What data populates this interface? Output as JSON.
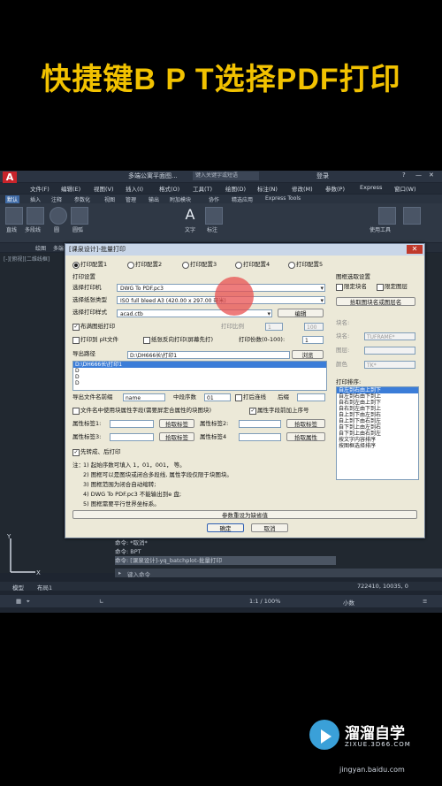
{
  "headline": "快捷键B P T选择PDF打印",
  "app": {
    "title_doc": "多端公寓平面图...",
    "search_placeholder": "键入关键字或短语",
    "login": "登录",
    "menu": [
      "文件(F)",
      "编辑(E)",
      "视图(V)",
      "插入(I)",
      "格式(O)",
      "工具(T)",
      "绘图(D)",
      "标注(N)",
      "修改(M)",
      "参数(P)",
      "Express",
      "窗口(W)"
    ],
    "ribbon_tabs": [
      "默认",
      "插入",
      "注释",
      "参数化",
      "视图",
      "管理",
      "输出",
      "附加模块",
      "协作",
      "精选应用",
      "Express Tools"
    ],
    "ribbon_buttons": [
      "直线",
      "多段线",
      "圆",
      "圆弧",
      "文字",
      "标注",
      "使用工具"
    ],
    "drawing_tabs": [
      "绘图",
      "多端公寓平面图"
    ],
    "viewport_label": "[-][俯视][二维线框]",
    "cmd_history": [
      "命令: *取消*",
      "命令: BPT",
      "命令: [课泉设计]-yq_batchplot-批量打印"
    ],
    "cmd_prompt": "键入命令",
    "layout_tabs": [
      "模型",
      "布局1"
    ],
    "coords": "722410, 10035, 0",
    "scale": "1:1 / 100%",
    "units": "小数"
  },
  "dialog": {
    "title": "[课泉设计]-批量打印",
    "configs": [
      "打印配置1",
      "打印配置2",
      "打印配置3",
      "打印配置4",
      "打印配置5"
    ],
    "print_settings": "打印设置",
    "label_printer": "选择打印机",
    "printer": "DWG To PDF.pc3",
    "label_paper": "选择纸张类型",
    "paper": "ISO full bleed A3 (420.00 x 297.00 毫米)",
    "label_style": "选择打印样式",
    "style": "acad.ctb",
    "edit": "编辑",
    "layout_print": "布满图纸打印",
    "scale_label": "打印比例",
    "scale_a": "1",
    "scale_b": "100",
    "plt_file": "打印到 plt文件",
    "reverse": "纸张反向打印(屏幕先打)",
    "copies_label": "打印份数(0-100):",
    "copies": "1",
    "export_path_label": "导出路径",
    "export_path": "D:\\DH666长\\打印1",
    "browse": "浏览",
    "path_list": [
      "D:\\DH666长\\打印1",
      "D",
      "D",
      "D"
    ],
    "filename_label": "导出文件名前缀",
    "filename": "name",
    "mid_label": "中段序数",
    "mid": "01",
    "print_order_chk": "打后连线",
    "suffix_label": "后缀",
    "file_attr": "文件名中使用块属性字段(需要屏定合属性的块图块)",
    "attr_prefix": "属性字段前加上序号",
    "attr1": "属性标签1:",
    "attr2": "属性标签2:",
    "attr3": "属性标签3:",
    "attr4": "属性标签4",
    "pick": "拾取标签",
    "pick_attr": "拾取属性",
    "first_print": "先转成、后打印",
    "note_title": "注：",
    "notes": [
      "1) 起始序数可填入 1，01，001， 等。",
      "2) 图框可以是图块或闭合多段线, 属性字段仅限于块图块。",
      "3) 图框范围为闭合自动缩转;",
      "4) DWG To PDF.pc3 不能输出到e 盘;",
      "5) 图框需要平行世界坐标系。"
    ],
    "reset": "参数重设为缺省值",
    "ok": "确定",
    "cancel": "取消",
    "right_group": "图框选取设置",
    "by_block": "限定块名",
    "by_layer": "限定图层",
    "pick_block_layer": "拾取图块名或图层名",
    "block_label": "块名:",
    "block_value": "TUFRAME*",
    "layer_label": "图层:",
    "layer_value": "",
    "color_label": "颜色",
    "color_value": "TK*",
    "print_order_label": "打印排序:",
    "orders": [
      "自左到右由上到下",
      "自左到右由下到上",
      "自右到左由上到下",
      "自右到左由下到上",
      "自上到下由左到右",
      "自上到下由右到左",
      "自下到上由左到右",
      "自下到上由右到左",
      "按文字内容排序",
      "按图框选择排序"
    ]
  },
  "watermark": {
    "name": "溜溜自学",
    "sub": "ZIXUE.3D66.COM"
  },
  "credit": "jingyan.baidu.com"
}
